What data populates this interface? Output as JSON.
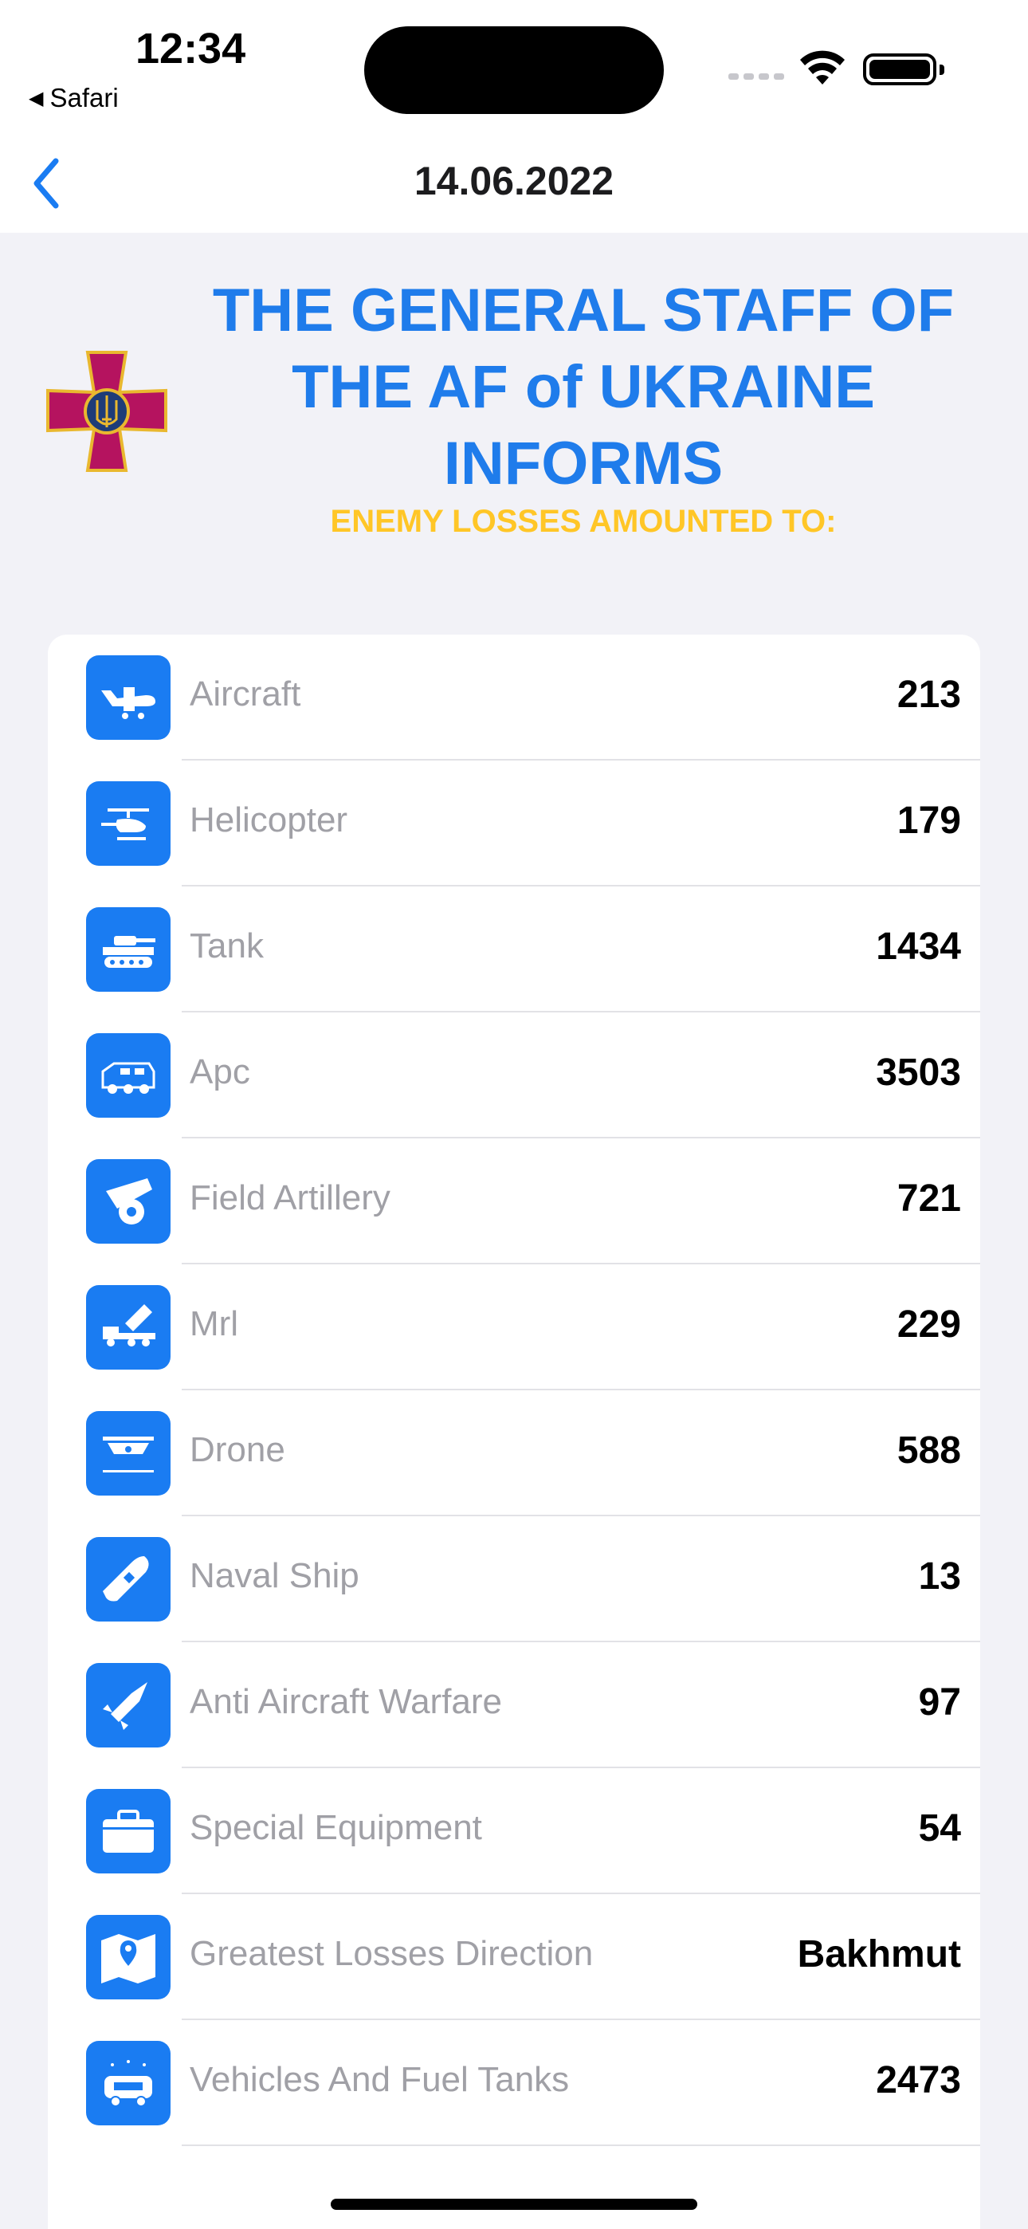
{
  "status": {
    "time": "12:34",
    "back_app": "Safari"
  },
  "nav": {
    "title": "14.06.2022"
  },
  "header": {
    "title": "THE GENERAL STAFF OF THE AF of UKRAINE INFORMS",
    "subtitle": "ENEMY LOSSES AMOUNTED TO:"
  },
  "colors": {
    "accent": "#1F7CEB",
    "icon_bg": "#1A7CF2",
    "subtitle": "#FFC627",
    "emblem": "#B5135F"
  },
  "losses": [
    {
      "icon": "aircraft-icon",
      "label": "Aircraft",
      "value": "213"
    },
    {
      "icon": "helicopter-icon",
      "label": "Helicopter",
      "value": "179"
    },
    {
      "icon": "tank-icon",
      "label": "Tank",
      "value": "1434"
    },
    {
      "icon": "apc-icon",
      "label": "Apc",
      "value": "3503"
    },
    {
      "icon": "cannon-icon",
      "label": "Field Artillery",
      "value": "721"
    },
    {
      "icon": "rocket-launcher-icon",
      "label": "Mrl",
      "value": "229"
    },
    {
      "icon": "drone-icon",
      "label": "Drone",
      "value": "588"
    },
    {
      "icon": "ship-icon",
      "label": "Naval Ship",
      "value": "13"
    },
    {
      "icon": "missile-icon",
      "label": "Anti Aircraft Warfare",
      "value": "97"
    },
    {
      "icon": "toolbox-icon",
      "label": "Special Equipment",
      "value": "54"
    },
    {
      "icon": "map-pin-icon",
      "label": "Greatest Losses Direction",
      "value": "Bakhmut"
    },
    {
      "icon": "fuel-truck-icon",
      "label": "Vehicles And Fuel Tanks",
      "value": "2473"
    }
  ]
}
